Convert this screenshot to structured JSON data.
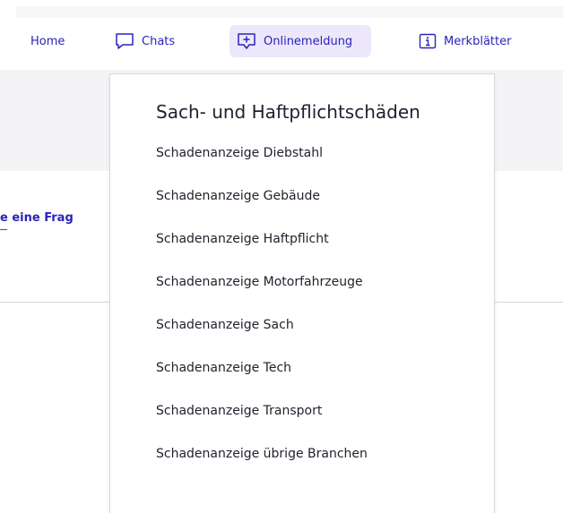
{
  "nav": {
    "items": [
      {
        "id": "home",
        "label": "Home",
        "icon": null
      },
      {
        "id": "chats",
        "label": "Chats",
        "icon": "chat-bubble-icon"
      },
      {
        "id": "onlinemeldung",
        "label": "Onlinemeldung",
        "icon": "report-plus-icon",
        "active": true
      },
      {
        "id": "merkblaetter",
        "label": "Merkblätter",
        "icon": "info-icon"
      }
    ]
  },
  "background": {
    "question_fragment": "e eine Frag"
  },
  "dropdown": {
    "heading": "Sach- und Haftpflichtschäden",
    "items": [
      "Schadenanzeige Diebstahl",
      "Schadenanzeige Gebäude",
      "Schadenanzeige Haftpflicht",
      "Schadenanzeige Motorfahrzeuge",
      "Schadenanzeige Sach",
      "Schadenanzeige Tech",
      "Schadenanzeige Transport",
      "Schadenanzeige übrige Branchen"
    ]
  },
  "colors": {
    "nav_text": "#2a23b8",
    "active_bg": "#ece7fb",
    "grey_band": "#f4f4f6"
  }
}
